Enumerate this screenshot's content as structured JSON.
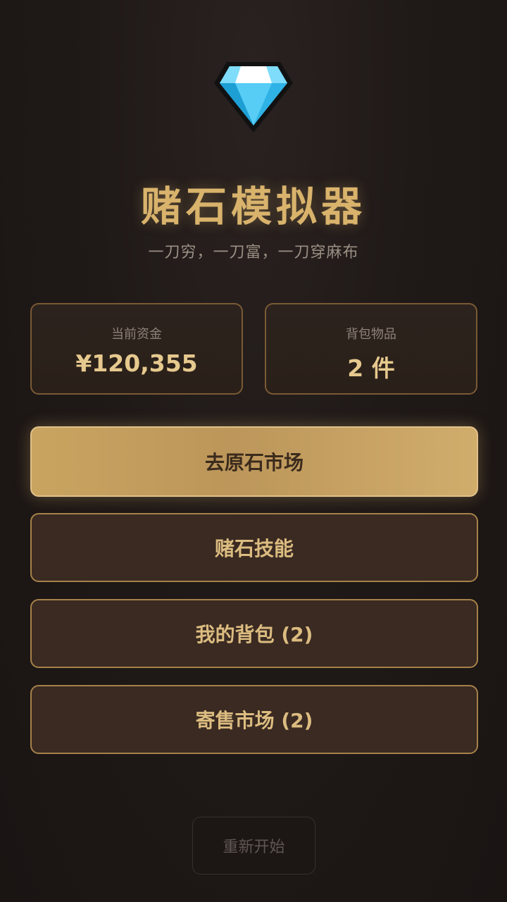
{
  "app": {
    "logo_icon": "diamond-icon",
    "title": "赌石模拟器",
    "subtitle": "一刀穷，一刀富，一刀穿麻布"
  },
  "stats": {
    "funds_label": "当前资金",
    "funds_value": "¥120,355",
    "inventory_label": "背包物品",
    "inventory_value": "2 件"
  },
  "menu": {
    "market_label": "去原石市场",
    "skills_label": "赌石技能",
    "backpack_label": "我的背包 (2)",
    "consignment_label": "寄售市场 (2)"
  },
  "footer": {
    "restart_label": "重新开始"
  },
  "colors": {
    "accent_gold": "#d9b36c",
    "button_bg": "#3a2a22",
    "diamond_blue": "#35c3f0"
  }
}
